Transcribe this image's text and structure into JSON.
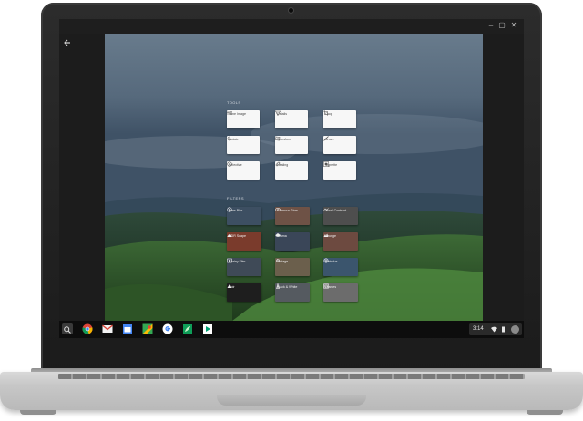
{
  "tools_section": {
    "title": "TOOLS",
    "items": [
      {
        "label": "Tune Image",
        "icon": "tune-icon"
      },
      {
        "label": "Details",
        "icon": "details-triangle-icon"
      },
      {
        "label": "Crop",
        "icon": "crop-icon"
      },
      {
        "label": "Rotate",
        "icon": "rotate-icon"
      },
      {
        "label": "Transform",
        "icon": "transform-icon"
      },
      {
        "label": "Brush",
        "icon": "brush-icon"
      },
      {
        "label": "Selective",
        "icon": "selective-target-icon"
      },
      {
        "label": "Healing",
        "icon": "healing-bandage-icon"
      },
      {
        "label": "Vignette",
        "icon": "vignette-icon"
      }
    ]
  },
  "filters_section": {
    "title": "FILTERS",
    "items": [
      {
        "label": "Lens Blur",
        "icon": "lens-blur-icon",
        "color": "#3d4f62"
      },
      {
        "label": "Glamour Glow",
        "icon": "glow-icon",
        "color": "#6e5246"
      },
      {
        "label": "Tonal Contrast",
        "icon": "contrast-icon",
        "color": "#4e4e4e"
      },
      {
        "label": "HDR Scape",
        "icon": "mountain-icon",
        "color": "#7a3b2c"
      },
      {
        "label": "Drama",
        "icon": "cloud-icon",
        "color": "#3a4658"
      },
      {
        "label": "Grunge",
        "icon": "grunge-icon",
        "color": "#6d4a40"
      },
      {
        "label": "Grainy Film",
        "icon": "film-icon",
        "color": "#3f4a57"
      },
      {
        "label": "Vintage",
        "icon": "gear-icon",
        "color": "#6b5f4c"
      },
      {
        "label": "Retrolux",
        "icon": "retrolux-icon",
        "color": "#3b556d"
      },
      {
        "label": "Noir",
        "icon": "noir-icon",
        "color": "#1e1e1e"
      },
      {
        "label": "Black & White",
        "icon": "tower-icon",
        "color": "#555a60"
      },
      {
        "label": "Frames",
        "icon": "frame-icon",
        "color": "#6c6c6c"
      }
    ]
  },
  "shelf": {
    "apps": [
      {
        "name": "chrome",
        "icon": "chrome-icon"
      },
      {
        "name": "gmail",
        "icon": "gmail-icon"
      },
      {
        "name": "calendar",
        "icon": "calendar-icon"
      },
      {
        "name": "maps",
        "icon": "maps-icon"
      },
      {
        "name": "google",
        "icon": "google-icon"
      },
      {
        "name": "snapseed",
        "icon": "snapseed-icon"
      },
      {
        "name": "play-store",
        "icon": "play-store-icon"
      }
    ],
    "status": {
      "time": "3:14"
    }
  },
  "colors": {
    "accent": "#4285f4",
    "shelf": "#0d0d0d",
    "card": "#f7f7f7"
  }
}
